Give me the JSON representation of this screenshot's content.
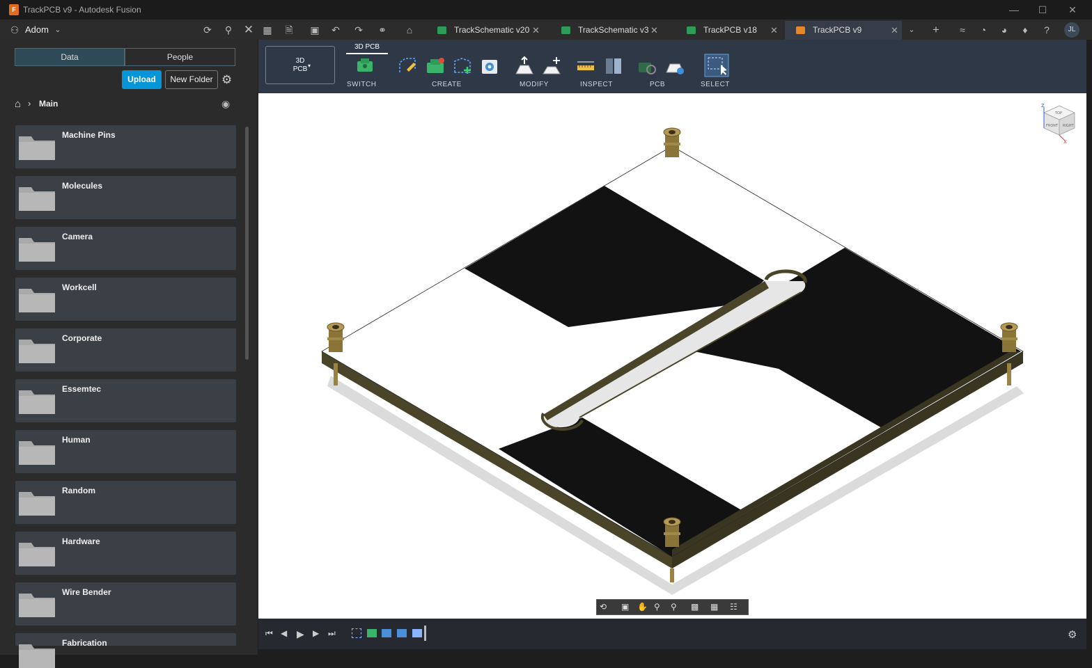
{
  "window": {
    "title": "TrackPCB v9 - Autodesk Fusion",
    "logo": "F"
  },
  "appbar": {
    "team": "Adom",
    "avatar": "JL"
  },
  "tabs": [
    {
      "label": "TrackSchematic v20"
    },
    {
      "label": "TrackSchematic v3"
    },
    {
      "label": "TrackPCB v18"
    },
    {
      "label": "TrackPCB v9"
    }
  ],
  "panel": {
    "seg_data": "Data",
    "seg_people": "People",
    "upload": "Upload",
    "new_folder": "New Folder",
    "breadcrumb": "Main",
    "folders": [
      "Machine Pins",
      "Molecules",
      "Camera",
      "Workcell",
      "Corporate",
      "Essemtec",
      "Human",
      "Random",
      "Hardware",
      "Wire Bender",
      "Fabrication"
    ]
  },
  "toolbar": {
    "workspace_line1": "3D",
    "workspace_line2": "PCB",
    "active_tab": "3D PCB",
    "groups": {
      "switch": "SWITCH",
      "create": "CREATE",
      "modify": "MODIFY",
      "inspect": "INSPECT",
      "pcb": "PCB",
      "select": "SELECT"
    }
  },
  "viewcube": {
    "top": "TOP",
    "front": "FRONT",
    "right": "RIGHT",
    "z": "Z",
    "x": "X"
  },
  "colors": {
    "accent": "#0696d7",
    "board_edge": "#4a4428",
    "pin": "#a08a4a"
  }
}
